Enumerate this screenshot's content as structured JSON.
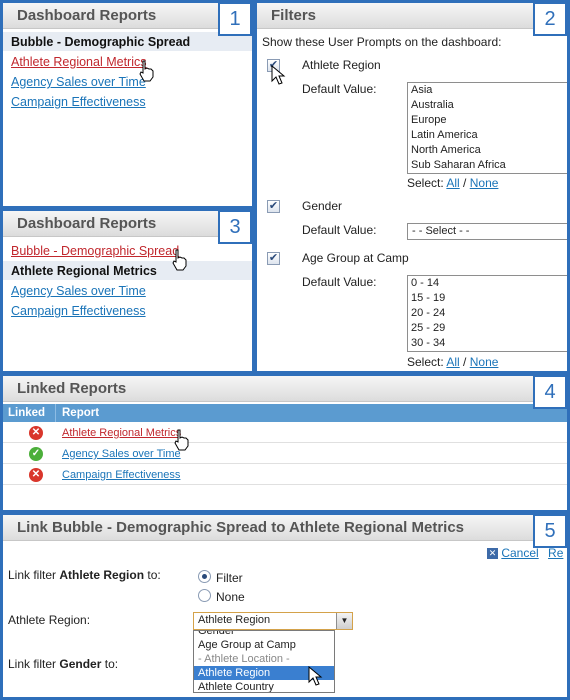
{
  "panel1": {
    "number": "1",
    "title": "Dashboard Reports",
    "items": [
      {
        "label": "Bubble - Demographic Spread"
      },
      {
        "label": "Athlete Regional Metrics"
      },
      {
        "label": "Agency Sales over Time"
      },
      {
        "label": "Campaign Effectiveness"
      }
    ]
  },
  "panel2": {
    "number": "2",
    "title": "Filters",
    "intro": "Show these User Prompts on the dashboard:",
    "default_value_label": "Default Value:",
    "select_label": "Select:",
    "select_all": "All",
    "select_separator": "/",
    "select_none": "None",
    "filters": [
      {
        "name": "Athlete Region",
        "checked": true,
        "options": [
          "Asia",
          "Australia",
          "Europe",
          "Latin America",
          "North America",
          "Sub Saharan Africa"
        ]
      },
      {
        "name": "Gender",
        "checked": true,
        "placeholder": "- - Select - -"
      },
      {
        "name": "Age Group at Camp",
        "checked": true,
        "options": [
          "0 - 14",
          "15 - 19",
          "20 - 24",
          "25 - 29",
          "30 - 34"
        ]
      }
    ]
  },
  "panel3": {
    "number": "3",
    "title": "Dashboard Reports",
    "items": [
      {
        "label": "Bubble - Demographic Spread"
      },
      {
        "label": "Athlete Regional Metrics"
      },
      {
        "label": "Agency Sales over Time"
      },
      {
        "label": "Campaign Effectiveness"
      }
    ]
  },
  "panel4": {
    "number": "4",
    "title": "Linked Reports",
    "col_linked": "Linked",
    "col_report": "Report",
    "rows": [
      {
        "linked": false,
        "report": "Athlete Regional Metrics"
      },
      {
        "linked": true,
        "report": "Agency Sales over Time"
      },
      {
        "linked": false,
        "report": "Campaign Effectiveness"
      }
    ],
    "status_colors": {
      "linked": "#4caf3a",
      "unlinked": "#d9362b"
    }
  },
  "panel5": {
    "number": "5",
    "title": "Link Bubble - Demographic Spread to Athlete Regional Metrics",
    "cancel": "Cancel",
    "truncated_action": "Re",
    "link_filter_prefix": "Link filter",
    "link_filter_suffix": "to:",
    "filter1_name": "Athlete Region",
    "filter2_name": "Gender",
    "radio_filter": "Filter",
    "radio_none": "None",
    "field_label": "Athlete Region:",
    "select_value": "Athlete Region",
    "dropdown": [
      "Gender",
      "Age Group at Camp",
      "- Athlete Location -",
      "Athlete Region",
      "Athlete Country"
    ]
  },
  "colors": {
    "accent": "#2f6fba",
    "link": "#1a74b8",
    "link_active": "#c1272d",
    "table_header": "#5b9bd0"
  }
}
